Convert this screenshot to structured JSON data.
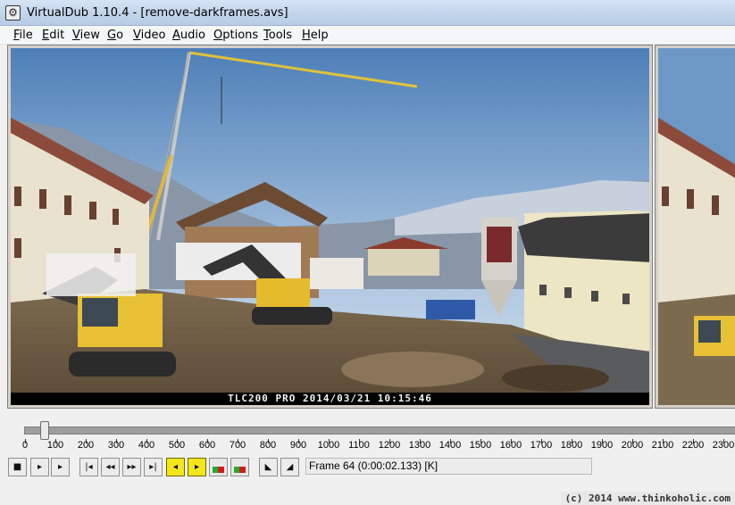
{
  "window": {
    "title": "VirtualDub 1.10.4 - [remove-darkframes.avs]"
  },
  "menu": [
    {
      "label": "File",
      "key": "F"
    },
    {
      "label": "Edit",
      "key": "E"
    },
    {
      "label": "View",
      "key": "V"
    },
    {
      "label": "Go",
      "key": "G"
    },
    {
      "label": "Video",
      "key": "V"
    },
    {
      "label": "Audio",
      "key": "A"
    },
    {
      "label": "Options",
      "key": "O"
    },
    {
      "label": "Tools",
      "key": "T"
    },
    {
      "label": "Help",
      "key": "H"
    }
  ],
  "video": {
    "overlay_text": "TLC200 PRO 2014/03/21 10:15:46"
  },
  "timeline": {
    "tick_labels": [
      "0",
      "100",
      "200",
      "300",
      "400",
      "500",
      "600",
      "700",
      "800",
      "900",
      "1000",
      "1100",
      "1200",
      "1300",
      "1400",
      "1500",
      "1600",
      "1700",
      "1800",
      "1900",
      "2000",
      "2100",
      "2200",
      "2300"
    ],
    "current_frame": 64
  },
  "toolbar": {
    "buttons": [
      "stop-icon",
      "play-input-icon",
      "play-output-icon",
      "go-start-icon",
      "prev-frame-icon",
      "next-frame-icon",
      "go-end-icon",
      "prev-keyframe-icon",
      "next-keyframe-icon",
      "prev-scene-icon",
      "next-scene-icon",
      "mark-in-icon",
      "mark-out-icon"
    ],
    "status": "Frame 64 (0:00:02.133) [K]"
  },
  "watermark": "(c) 2014 www.thinkoholic.com"
}
